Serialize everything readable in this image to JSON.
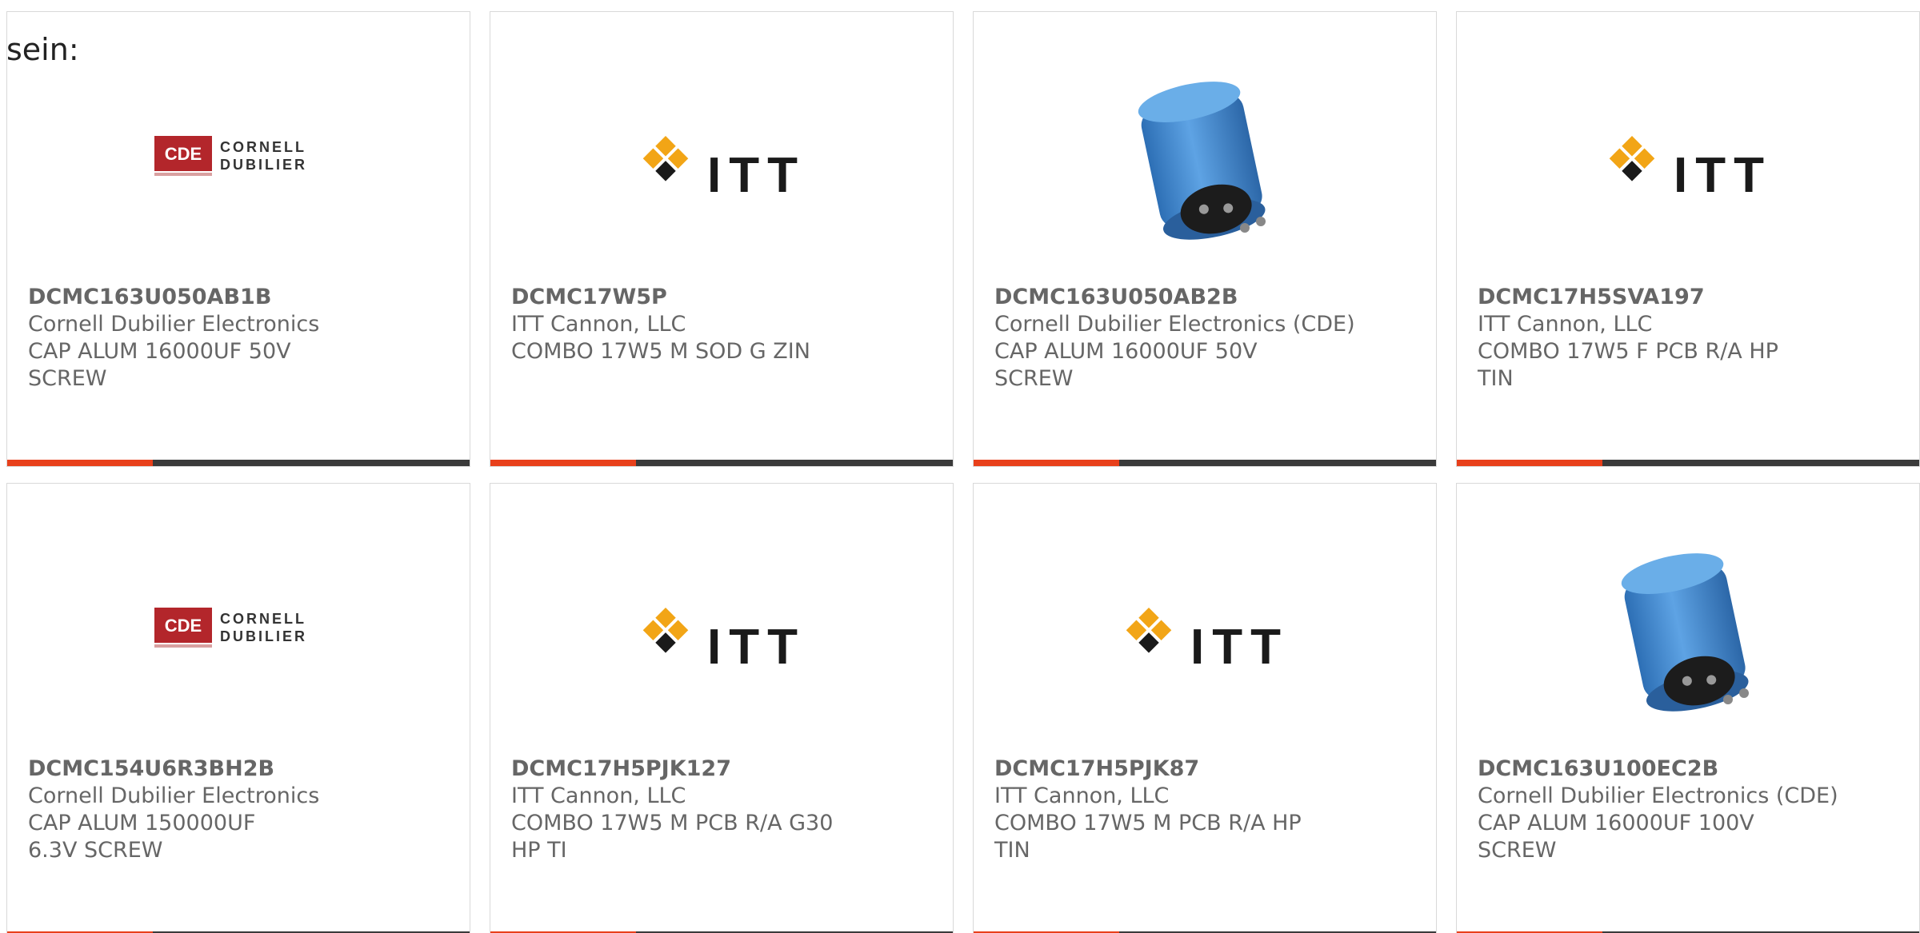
{
  "intro_text": "sein:",
  "colors": {
    "accent": "#e8401b",
    "bar": "#3a3a3a",
    "text": "#666666",
    "card_border": "#d9d9d9"
  },
  "cards": [
    {
      "image": "cornell-dubilier-logo",
      "part_number": "DCMC163U050AB1B",
      "manufacturer": "Cornell Dubilier Electronics",
      "description": "CAP ALUM 16000UF 50V SCREW"
    },
    {
      "image": "itt-logo",
      "part_number": "DCMC17W5P",
      "manufacturer": "ITT Cannon, LLC",
      "description": "COMBO 17W5 M SOD G ZIN"
    },
    {
      "image": "capacitor-photo",
      "part_number": "DCMC163U050AB2B",
      "manufacturer": "Cornell Dubilier Electronics (CDE)",
      "description": "CAP ALUM 16000UF 50V SCREW"
    },
    {
      "image": "itt-logo",
      "part_number": "DCMC17H5SVA197",
      "manufacturer": "ITT Cannon, LLC",
      "description": "COMBO 17W5 F PCB R/A HP TIN"
    },
    {
      "image": "cornell-dubilier-logo",
      "part_number": "DCMC154U6R3BH2B",
      "manufacturer": "Cornell Dubilier Electronics",
      "description": "CAP ALUM 150000UF 6.3V SCREW"
    },
    {
      "image": "itt-logo",
      "part_number": "DCMC17H5PJK127",
      "manufacturer": "ITT Cannon, LLC",
      "description": "COMBO 17W5 M PCB R/A G30 HP TI"
    },
    {
      "image": "itt-logo",
      "part_number": "DCMC17H5PJK87",
      "manufacturer": "ITT Cannon, LLC",
      "description": "COMBO 17W5 M PCB R/A HP TIN"
    },
    {
      "image": "capacitor-photo",
      "part_number": "DCMC163U100EC2B",
      "manufacturer": "Cornell Dubilier Electronics (CDE)",
      "description": "CAP ALUM 16000UF 100V SCREW"
    }
  ]
}
